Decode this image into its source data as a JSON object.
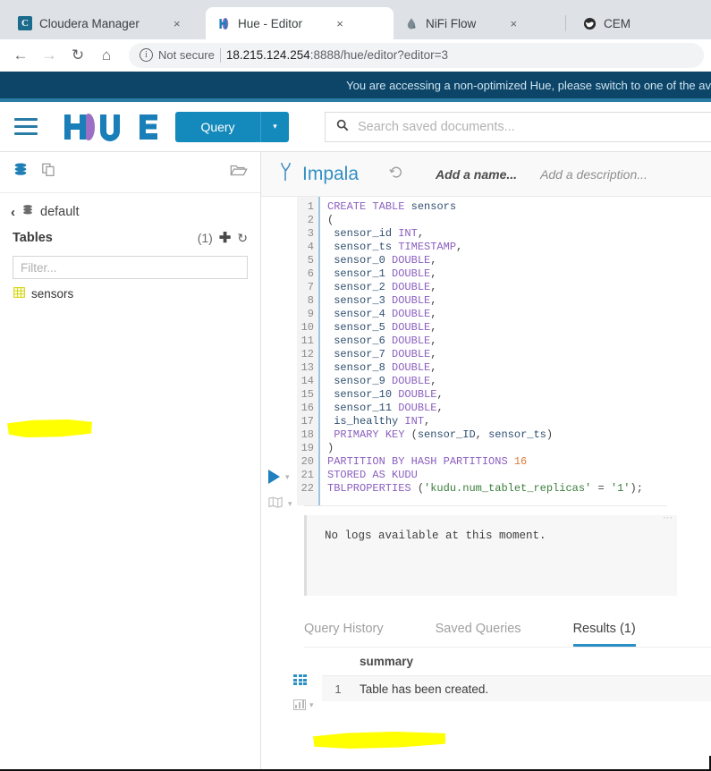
{
  "browser": {
    "tabs": [
      {
        "title": "Cloudera Manager",
        "favicon": "cloudera-icon",
        "active": false,
        "close": "×"
      },
      {
        "title": "Hue - Editor",
        "favicon": "hue-icon",
        "active": true,
        "close": "×"
      },
      {
        "title": "NiFi Flow",
        "favicon": "nifi-icon",
        "active": false,
        "close": "×"
      },
      {
        "title": "CEM",
        "favicon": "cem-icon",
        "active": false,
        "close": ""
      }
    ],
    "toolbar": {
      "back": "←",
      "forward": "→",
      "reload": "↻",
      "home": "⌂",
      "info_glyph": "i",
      "security_label": "Not secure",
      "url_host": "18.215.124.254",
      "url_path": ":8888/hue/editor?editor=3"
    }
  },
  "banner": {
    "message": "You are accessing a non-optimized Hue, please switch to one of the av",
    "bg_color": "#0c4568"
  },
  "topnav": {
    "menu_icon": "hamburger-icon",
    "logo_text": "hue",
    "query_button": "Query",
    "query_caret": "▾",
    "search_icon": "search-icon",
    "search_placeholder": "Search saved documents..."
  },
  "assist": {
    "icons": {
      "database": "database-icon",
      "documents": "documents-icon",
      "folder": "open-folder-icon"
    },
    "breadcrumb_back": "‹",
    "breadcrumb_db": "default",
    "tables_label": "Tables",
    "tables_count": "(1)",
    "add_icon": "✚",
    "refresh_icon": "↻",
    "filter_placeholder": "Filter...",
    "tables": [
      {
        "name": "sensors",
        "icon": "table-icon",
        "highlighted": true
      }
    ]
  },
  "editor": {
    "engine_icon": "impala-icon",
    "engine_name": "Impala",
    "history_icon": "history-icon",
    "name_placeholder": "Add a name...",
    "description_placeholder": "Add a description...",
    "run_icon": "run-triangle-icon",
    "run_caret": "▾",
    "book_icon": "book-icon",
    "book_caret": "▾",
    "sql_lines": [
      "CREATE TABLE sensors",
      "(",
      " sensor_id INT,",
      " sensor_ts TIMESTAMP,",
      " sensor_0 DOUBLE,",
      " sensor_1 DOUBLE,",
      " sensor_2 DOUBLE,",
      " sensor_3 DOUBLE,",
      " sensor_4 DOUBLE,",
      " sensor_5 DOUBLE,",
      " sensor_6 DOUBLE,",
      " sensor_7 DOUBLE,",
      " sensor_8 DOUBLE,",
      " sensor_9 DOUBLE,",
      " sensor_10 DOUBLE,",
      " sensor_11 DOUBLE,",
      " is_healthy INT,",
      " PRIMARY KEY (sensor_ID, sensor_ts)",
      ")",
      "PARTITION BY HASH PARTITIONS 16",
      "STORED AS KUDU",
      "TBLPROPERTIES ('kudu.num_tablet_replicas' = '1');"
    ],
    "line_count": 22
  },
  "logs": {
    "dots": "⋯",
    "message": "No logs available at this moment."
  },
  "results": {
    "tabs": [
      {
        "label": "Query History",
        "active": false
      },
      {
        "label": "Saved Queries",
        "active": false
      },
      {
        "label": "Results (1)",
        "active": true
      }
    ],
    "grid_icon": "grid-view-icon",
    "chart_icon": "chart-view-icon",
    "chart_caret": "▾",
    "columns": [
      "summary"
    ],
    "rows": [
      {
        "index": "1",
        "summary": "Table has been created.",
        "highlighted": true
      }
    ]
  },
  "colors": {
    "accent_blue": "#1489bb",
    "banner_navy": "#0c4568",
    "highlight_yellow": "#ffff00",
    "tab_active_underline": "#2a8fc4"
  }
}
